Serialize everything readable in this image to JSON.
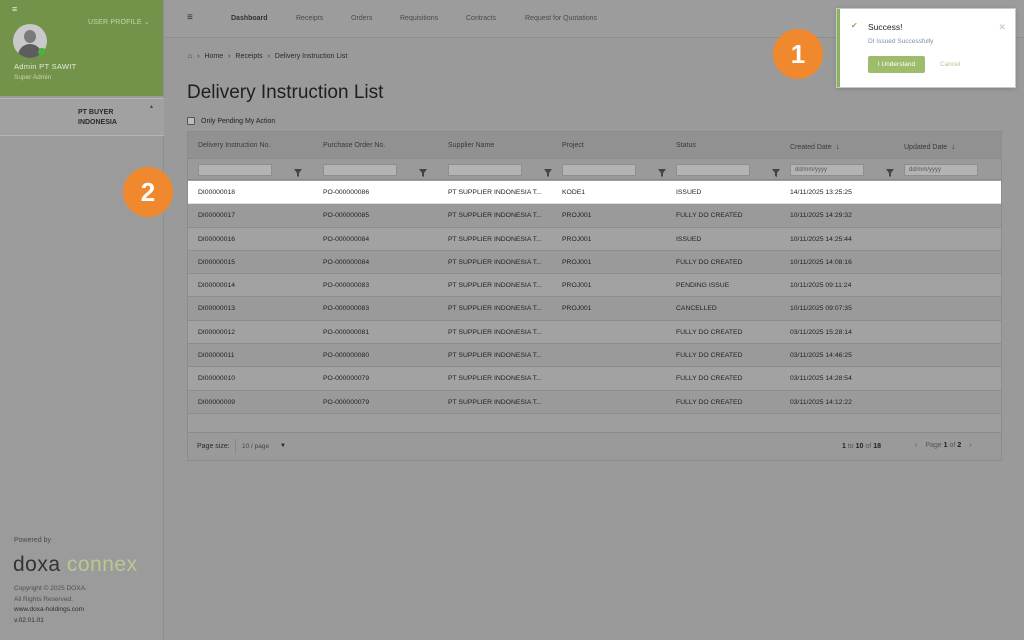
{
  "sidebar": {
    "menu_glyph": "≡",
    "user_profile_label": "USER PROFILE ⌄",
    "user_name": "Admin PT SAWIT",
    "user_role": "Super Admin",
    "company_name": "PT BUYER INDONESIA",
    "powered_by": "Powered by",
    "brand_part1": "doxa ",
    "brand_part2": "connex",
    "copyright": "Copyright © 2025 DOXA.",
    "rights": "All Rights Reserved.",
    "website": "www.doxa-holdings.com",
    "version": "v.02.01.01"
  },
  "topnav": {
    "menu_glyph": "≡",
    "items": [
      "Dashboard",
      "Receipts",
      "Orders",
      "Requisitions",
      "Contracts",
      "Request for Quotations"
    ]
  },
  "breadcrumb": {
    "home_icon": "⌂",
    "items": [
      "Home",
      "Receipts",
      "Delivery Instruction List"
    ]
  },
  "page": {
    "title": "Delivery Instruction List",
    "pending_filter_label": "Only Pending My Action"
  },
  "table": {
    "columns": [
      "Delivery Instruction No.",
      "Purchase Order No.",
      "Supplier Name",
      "Project",
      "Status",
      "Created Date",
      "Updated Date"
    ],
    "date_placeholder": "dd/mm/yyyy",
    "rows": [
      [
        "DI00000018",
        "PO-000000086",
        "PT SUPPLIER INDONESIA T...",
        "KODE1",
        "ISSUED",
        "14/11/2025 13:25:25"
      ],
      [
        "DI00000017",
        "PO-000000085",
        "PT SUPPLIER INDONESIA T...",
        "PROJ001",
        "FULLY DO CREATED",
        "10/11/2025 14:29:32"
      ],
      [
        "DI00000016",
        "PO-000000084",
        "PT SUPPLIER INDONESIA T...",
        "PROJ001",
        "ISSUED",
        "10/11/2025 14:25:44"
      ],
      [
        "DI00000015",
        "PO-000000084",
        "PT SUPPLIER INDONESIA T...",
        "PROJ001",
        "FULLY DO CREATED",
        "10/11/2025 14:08:16"
      ],
      [
        "DI00000014",
        "PO-000000083",
        "PT SUPPLIER INDONESIA T...",
        "PROJ001",
        "PENDING ISSUE",
        "10/11/2025 09:11:24"
      ],
      [
        "DI00000013",
        "PO-000000083",
        "PT SUPPLIER INDONESIA T...",
        "PROJ001",
        "CANCELLED",
        "10/11/2025 09:07:35"
      ],
      [
        "DI00000012",
        "PO-000000081",
        "PT SUPPLIER INDONESIA T...",
        "",
        "FULLY DO CREATED",
        "03/11/2025 15:28:14"
      ],
      [
        "DI00000011",
        "PO-000000080",
        "PT SUPPLIER INDONESIA T...",
        "",
        "FULLY DO CREATED",
        "03/11/2025 14:46:25"
      ],
      [
        "DI00000010",
        "PO-000000079",
        "PT SUPPLIER INDONESIA T...",
        "",
        "FULLY DO CREATED",
        "03/11/2025 14:28:54"
      ],
      [
        "DI00000009",
        "PO-000000079",
        "PT SUPPLIER INDONESIA T...",
        "",
        "FULLY DO CREATED",
        "03/11/2025 14:12:22"
      ]
    ],
    "page_size_label": "Page size:",
    "page_size_value": "10 / page",
    "range_from": "1",
    "range_to_label": "to",
    "range_to": "10",
    "range_of_label": "of",
    "range_total": "18",
    "page_label": "Page",
    "page_current": "1",
    "page_of_label": "of",
    "page_total": "2"
  },
  "toast": {
    "title": "Success!",
    "message": "DI Issued Successfully",
    "confirm_label": "I Understand",
    "cancel_label": "Cancel",
    "close_glyph": "✕",
    "check_glyph": "✔"
  },
  "badges": [
    "1",
    "2"
  ],
  "colors": {
    "brand_green": "#74934a",
    "accent_orange": "#f0892d",
    "success_green": "#9ebd6c"
  }
}
